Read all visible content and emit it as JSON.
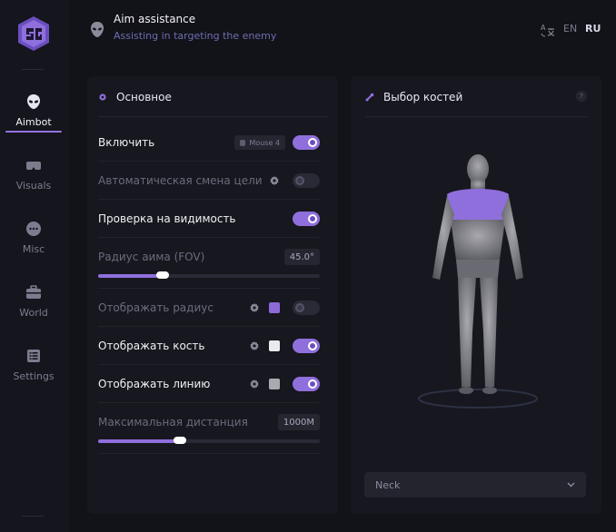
{
  "sidebar": {
    "items": [
      {
        "label": "Aimbot",
        "icon": "alien-head-icon",
        "active": true
      },
      {
        "label": "Visuals",
        "icon": "vr-glasses-icon",
        "active": false
      },
      {
        "label": "Misc",
        "icon": "chat-dots-icon",
        "active": false
      },
      {
        "label": "World",
        "icon": "briefcase-icon",
        "active": false
      },
      {
        "label": "Settings",
        "icon": "list-icon",
        "active": false
      }
    ]
  },
  "header": {
    "title": "Aim assistance",
    "subtitle": "Assisting in targeting the enemy",
    "lang_en": "EN",
    "lang_ru": "RU"
  },
  "left_panel": {
    "title": "Основное",
    "rows": {
      "enable": {
        "label": "Включить",
        "keybind": "Mouse 4",
        "on": true
      },
      "auto_switch": {
        "label": "Автоматическая смена цели",
        "on": false
      },
      "visibility": {
        "label": "Проверка на видимость",
        "on": true
      },
      "fov": {
        "label": "Радиус аима (FOV)",
        "value": "45.0°",
        "fill_percent": 29
      },
      "show_radius": {
        "label": "Отображать радиус",
        "on": false,
        "color": "#8b6ad8"
      },
      "show_bone": {
        "label": "Отображать кость",
        "on": true,
        "color": "#e9e9ee"
      },
      "show_line": {
        "label": "Отображать линию",
        "on": true,
        "color": "#a9a9b0"
      },
      "max_distance": {
        "label": "Максимальная дистанция",
        "value": "1000М",
        "fill_percent": 37
      }
    }
  },
  "right_panel": {
    "title": "Выбор костей",
    "help": "?",
    "bone_select": "Neck"
  },
  "colors": {
    "accent": "#8f6fdc",
    "background": "#121219",
    "panel": "#17171f"
  }
}
